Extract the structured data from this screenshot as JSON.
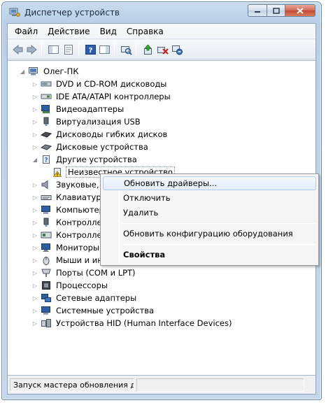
{
  "window": {
    "title": "Диспетчер устройств",
    "accent": "#b9d0e6",
    "close_color": "#c04a33"
  },
  "menubar": {
    "items": [
      "Файл",
      "Действие",
      "Вид",
      "Справка"
    ]
  },
  "toolbar": {
    "icons": [
      "back-arrow-icon",
      "forward-arrow-icon",
      "show-hide-console-tree-icon",
      "properties-icon",
      "help-icon",
      "action-pane-icon",
      "scan-hardware-icon",
      "update-driver-icon",
      "uninstall-icon",
      "disable-icon"
    ]
  },
  "tree": {
    "root": "Олег-ПК",
    "items": [
      "DVD и CD-ROM дисководы",
      "IDE ATA/ATAPI контроллеры",
      "Видеоадаптеры",
      "Виртуализация USB",
      "Дисководы гибких дисков",
      "Дисковые устройства",
      "Другие устройства",
      "Неизвестное устройство",
      "Звуковые, в",
      "Клавиатуры",
      "Компьютер",
      "Контроллер",
      "Контроллер",
      "Мониторы",
      "Мыши и ин",
      "Порты (COM и LPT)",
      "Процессоры",
      "Сетевые адаптеры",
      "Системные устройства",
      "Устройства HID (Human Interface Devices)"
    ]
  },
  "context_menu": {
    "update_drivers": "Обновить драйверы...",
    "disable": "Отключить",
    "delete": "Удалить",
    "scan_hardware": "Обновить конфигурацию оборудования",
    "properties": "Свойства"
  },
  "status": {
    "text": "Запуск мастера обновления др"
  }
}
